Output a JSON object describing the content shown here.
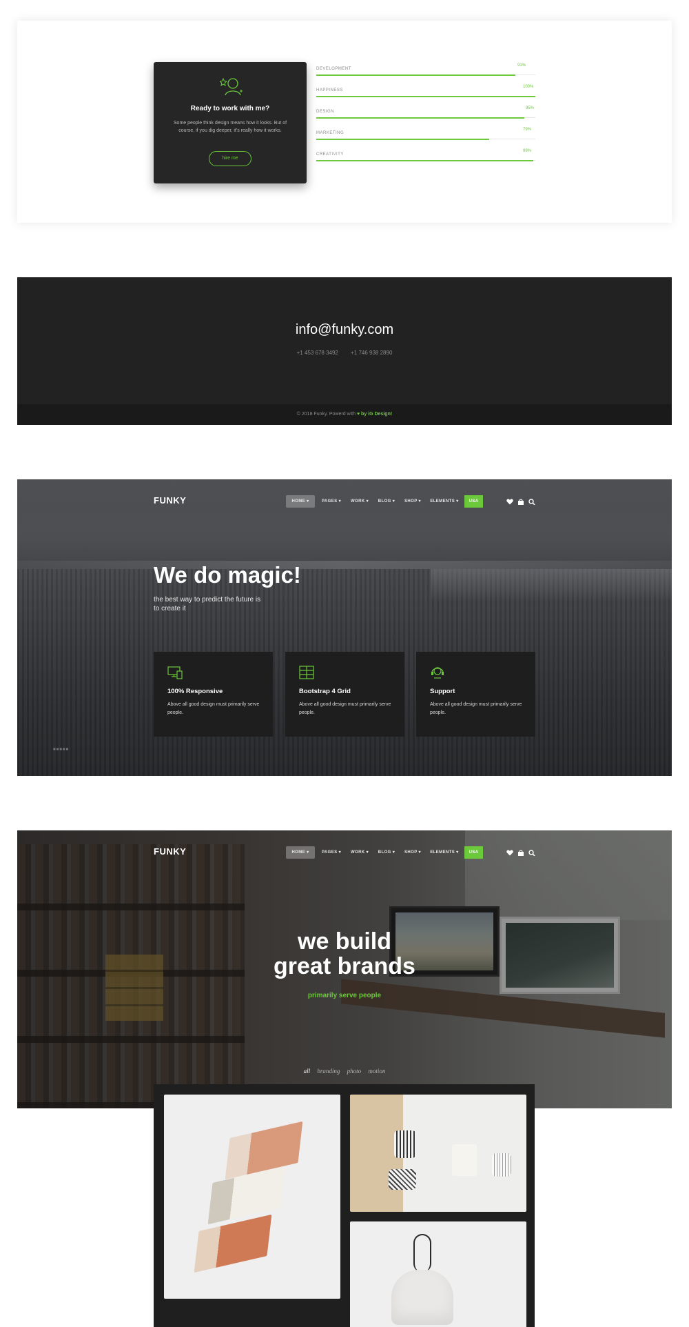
{
  "skills_section": {
    "card": {
      "title": "Ready to work with me?",
      "text": "Some people think design means how it looks. But of course, if you dig deeper, it's really how it works.",
      "button_label": "hire me",
      "icon": "person-star-icon"
    },
    "skills": [
      {
        "name": "DEVELOPMENT",
        "percent_label": "91%",
        "value": 91
      },
      {
        "name": "HAPPINESS",
        "percent_label": "100%",
        "value": 100
      },
      {
        "name": "DESIGN",
        "percent_label": "95%",
        "value": 95
      },
      {
        "name": "MARKETING",
        "percent_label": "79%",
        "value": 79
      },
      {
        "name": "CREATIVITY",
        "percent_label": "99%",
        "value": 99
      }
    ]
  },
  "contact_section": {
    "email": "info@funky.com",
    "phones": [
      "+1 453 678 3492",
      "+1 746 938 2890"
    ],
    "copyright_prefix": "© 2018 Funky. Powerd with",
    "copyright_by": "by",
    "credit": "iG Design!",
    "heart_icon": "heart-icon"
  },
  "nav": {
    "logo": "FUNKY",
    "items": [
      "HOME ▾",
      "PAGES ▾",
      "WORK ▾",
      "BLOG ▾",
      "SHOP ▾",
      "ELEMENTS ▾"
    ],
    "lang_label": "USA",
    "icons": [
      "heart-icon",
      "bag-icon",
      "search-icon"
    ]
  },
  "magic_hero": {
    "title": "We do magic!",
    "subtitle": "the best way to predict the future is to create it",
    "features": [
      {
        "title": "100% Responsive",
        "text": "Above all good design must primarily serve people.",
        "icon": "devices-icon"
      },
      {
        "title": "Bootstrap 4 Grid",
        "text": "Above all good design must primarily serve people.",
        "icon": "grid-icon"
      },
      {
        "title": "Support",
        "text": "Above all good design must primarily serve people.",
        "icon": "headset-icon"
      }
    ],
    "slider_dots": "■■■■■"
  },
  "brands_hero": {
    "title_line1": "we build",
    "title_line2": "great brands",
    "subtitle": "primarily serve people",
    "filters": [
      "all",
      "branding",
      "photo",
      "motion"
    ]
  },
  "colors": {
    "accent": "#6cc93b",
    "dark": "#222222",
    "card": "#1e1e1e"
  }
}
